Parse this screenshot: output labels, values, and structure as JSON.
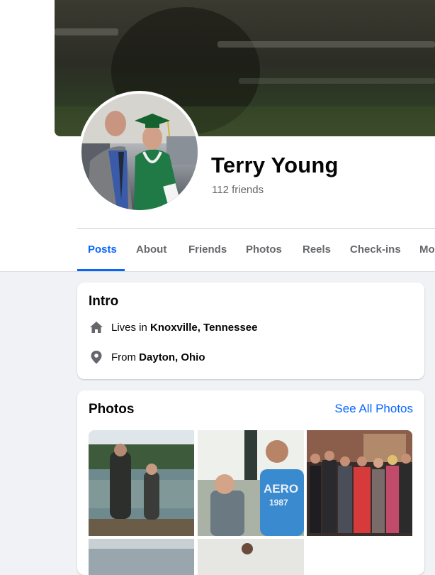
{
  "profile": {
    "name": "Terry Young",
    "friends_count": "112 friends"
  },
  "tabs": [
    {
      "label": "Posts",
      "active": true
    },
    {
      "label": "About"
    },
    {
      "label": "Friends"
    },
    {
      "label": "Photos"
    },
    {
      "label": "Reels"
    },
    {
      "label": "Check-ins"
    },
    {
      "label": "Mo"
    }
  ],
  "intro": {
    "title": "Intro",
    "lives_prefix": "Lives in ",
    "lives_value": "Knoxville, Tennessee",
    "from_prefix": "From ",
    "from_value": "Dayton, Ohio"
  },
  "photos": {
    "title": "Photos",
    "see_all": "See All Photos",
    "aero_text": "AERO",
    "aero_year": "1987"
  },
  "colors": {
    "accent": "#0866ff",
    "secondary_text": "#65676b",
    "background": "#f0f2f5"
  },
  "icons": [
    "home-icon",
    "location-pin-icon"
  ]
}
